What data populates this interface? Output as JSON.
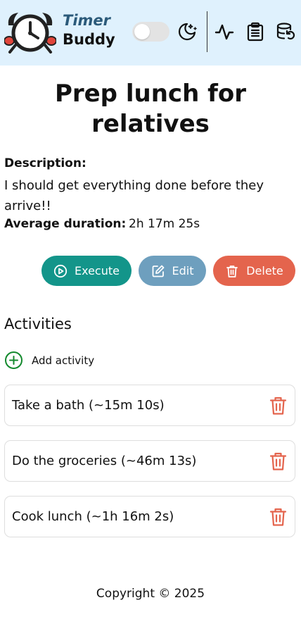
{
  "header": {
    "brand_line1": "Timer",
    "brand_line2": "Buddy",
    "logo_icon": "alarm-clock-logo",
    "theme_toggle_on": false,
    "icons": [
      "moon-icon",
      "activity-pulse-icon",
      "clipboard-list-icon",
      "database-restore-icon"
    ]
  },
  "routine": {
    "title": "Prep lunch for relatives",
    "description_label": "Description:",
    "description": "I should get everything done before they arrive!!",
    "duration_label": "Average duration:",
    "duration_value": "2h 17m 25s"
  },
  "actions": {
    "execute_label": "Execute",
    "edit_label": "Edit",
    "delete_label": "Delete"
  },
  "activities": {
    "heading": "Activities",
    "add_label": "Add activity",
    "items": [
      {
        "label": "Take a bath (~15m 10s)"
      },
      {
        "label": "Do the groceries (~46m 13s)"
      },
      {
        "label": "Cook lunch (~1h 16m 2s)"
      }
    ]
  },
  "footer": {
    "copyright": "Copyright © 2025"
  },
  "colors": {
    "header_bg": "#dff1fd",
    "execute": "#13958a",
    "edit": "#6e9fbe",
    "delete": "#e4644d",
    "add_green": "#148a2e",
    "trash_red": "#e4644d"
  }
}
